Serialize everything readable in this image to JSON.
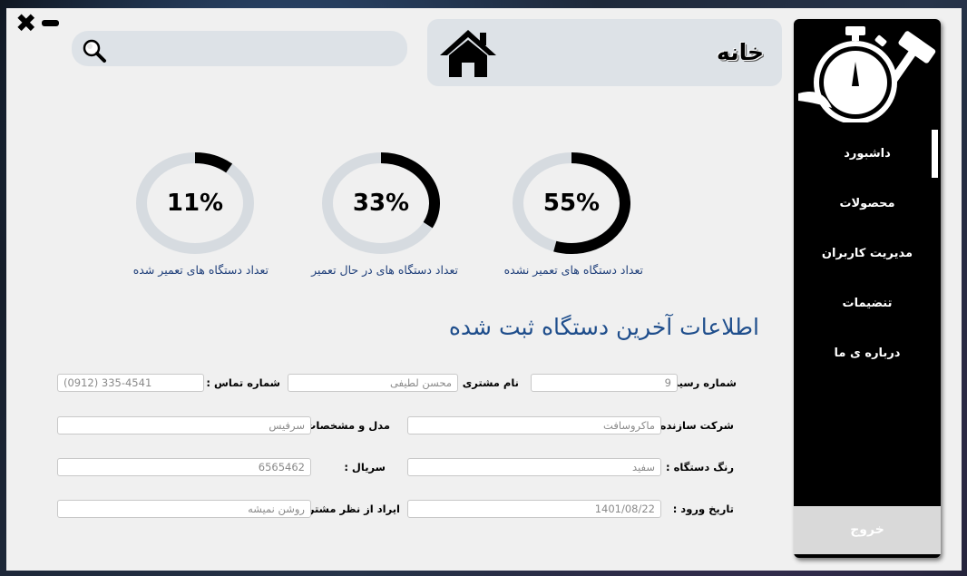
{
  "window": {
    "close_glyph": "✖",
    "minimize_glyph": "▬"
  },
  "header": {
    "title": "خانه",
    "icons": {
      "home": "home-icon",
      "search": "search-icon"
    }
  },
  "search": {
    "placeholder": ""
  },
  "sidebar": {
    "items": [
      {
        "label": "داشبورد",
        "active": true
      },
      {
        "label": "محصولات"
      },
      {
        "label": "مدیریت کاربران"
      },
      {
        "label": "تنضیمات"
      },
      {
        "label": "درباره ی ما"
      }
    ],
    "logout_label": "خروج",
    "logo_icon": "stopwatch-hammer-icon"
  },
  "gauges": [
    {
      "percent_text": "55%",
      "value": 0.55,
      "label": "تعداد دستگاه های تعمیر نشده"
    },
    {
      "percent_text": "33%",
      "value": 0.33,
      "label": "تعداد دستگاه های در حال تعمیر"
    },
    {
      "percent_text": "11%",
      "value": 0.11,
      "label": "تعداد دستگاه های تعمیر شده"
    }
  ],
  "section_title": "اطلاعات آخرین دستگاه ثبت شده",
  "form": {
    "receipt_no": {
      "label": "شماره رسید :",
      "value": "9"
    },
    "customer_name": {
      "label": "نام مشتری :",
      "value": "محسن لطیفی"
    },
    "phone": {
      "label": "شماره تماس :",
      "value": "(0912) 335-4541"
    },
    "manufacturer": {
      "label": "شرکت سازنده :",
      "value": "ماکروسافت"
    },
    "model": {
      "label": "مدل و مشخصات :",
      "value": "سرفیس"
    },
    "color": {
      "label": "رنگ دستگاه :",
      "value": "سفید"
    },
    "serial": {
      "label": "سریال :",
      "value": "6565462"
    },
    "entry_date": {
      "label": "تاریخ ورود :",
      "value": "1401/08/22"
    },
    "issue": {
      "label": "ایراد از نظر مشتری :",
      "value": "روشن نمیشه"
    }
  },
  "colors": {
    "accent": "#1f4e8c",
    "gauge_fill": "#000000",
    "gauge_track": "#d6dbe0",
    "sidebar_bg": "#000000",
    "panel_bg": "#dde2e7"
  }
}
